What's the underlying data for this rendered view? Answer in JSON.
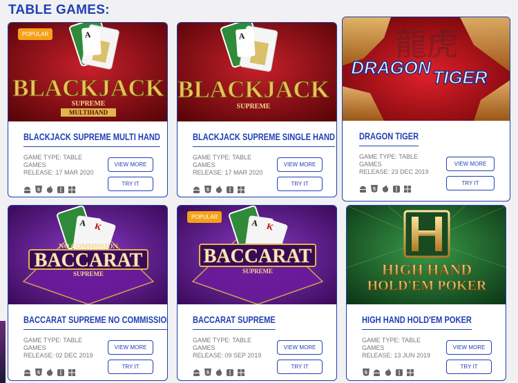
{
  "section_title": "TABLE GAMES:",
  "labels": {
    "view_more": "VIEW MORE",
    "try_it": "TRY IT",
    "game_type_prefix": "GAME TYPE: ",
    "release_prefix": "RELEASE: "
  },
  "colors": {
    "brand_blue": "#1f3fb4",
    "badge_orange": "#f5a11a",
    "card_red": "#a8101c",
    "card_purple": "#5a1a8a",
    "card_green": "#1e6b2e"
  },
  "platform_icons": [
    "android-icon",
    "html5-icon",
    "apple-icon",
    "mac-finder-icon",
    "windows-icon"
  ],
  "games": [
    {
      "title": "BLACKJACK SUPREME MULTI HAND",
      "game_type": "TABLE GAMES",
      "release": "17 MAR 2020",
      "badge": "POPULAR",
      "logo_line1": "BLACKJACK",
      "logo_line2": "SUPREME",
      "logo_line3": "MULTIHAND",
      "theme": "red"
    },
    {
      "title": "BLACKJACK SUPREME SINGLE HAND",
      "game_type": "TABLE GAMES",
      "release": "17 MAR 2020",
      "badge": "",
      "logo_line1": "BLACKJACK",
      "logo_line2": "SUPREME",
      "logo_line3": "",
      "theme": "red"
    },
    {
      "title": "DRAGON TIGER",
      "game_type": "TABLE GAMES",
      "release": "23 DEC 2019",
      "badge": "",
      "logo_line1": "DRAGON",
      "logo_line2": "TIGER",
      "logo_line3": "",
      "theme": "dragon"
    },
    {
      "title": "BACCARAT SUPREME NO COMMISSION",
      "game_type": "TABLE GAMES",
      "release": "02 DEC 2019",
      "badge": "",
      "logo_line1": "BACCARAT",
      "logo_line2": "SUPREME",
      "logo_line3": "NO COMMISSION",
      "theme": "purple"
    },
    {
      "title": "BACCARAT SUPREME",
      "game_type": "TABLE GAMES",
      "release": "09 SEP 2019",
      "badge": "POPULAR",
      "logo_line1": "BACCARAT",
      "logo_line2": "SUPREME",
      "logo_line3": "",
      "theme": "purple"
    },
    {
      "title": "HIGH HAND HOLD'EM POKER",
      "game_type": "TABLE GAMES",
      "release": "13 JUN 2019",
      "badge": "",
      "logo_line1": "HIGH HAND",
      "logo_line2": "HOLD'EM POKER",
      "logo_line3": "",
      "theme": "green"
    }
  ]
}
